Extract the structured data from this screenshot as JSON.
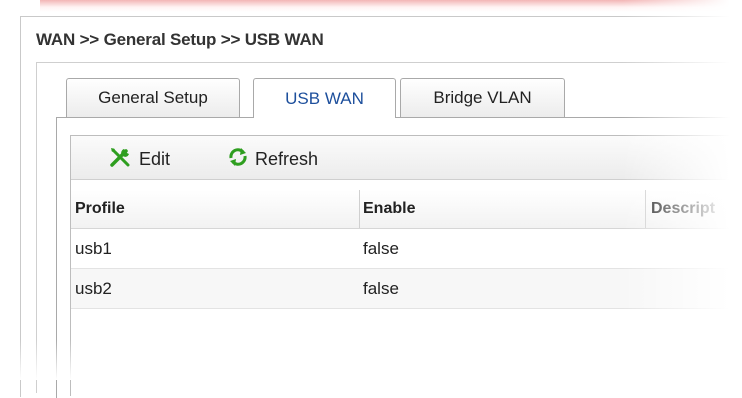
{
  "page": {
    "title": "WAN >> General Setup >> USB WAN"
  },
  "tabs": [
    {
      "label": "General Setup",
      "active": false
    },
    {
      "label": "USB WAN",
      "active": true
    },
    {
      "label": "Bridge VLAN",
      "active": false
    }
  ],
  "toolbar": {
    "edit_label": "Edit",
    "refresh_label": "Refresh",
    "edit_icon": "tools-icon",
    "refresh_icon": "refresh-icon"
  },
  "table": {
    "columns": [
      "Profile",
      "Enable",
      "Descript"
    ],
    "rows": [
      {
        "profile": "usb1",
        "enable": "false"
      },
      {
        "profile": "usb2",
        "enable": "false"
      }
    ]
  },
  "colors": {
    "accent": "#1d4f9c",
    "icon_green": "#2e9e1f",
    "header_glow": "#e87878"
  }
}
